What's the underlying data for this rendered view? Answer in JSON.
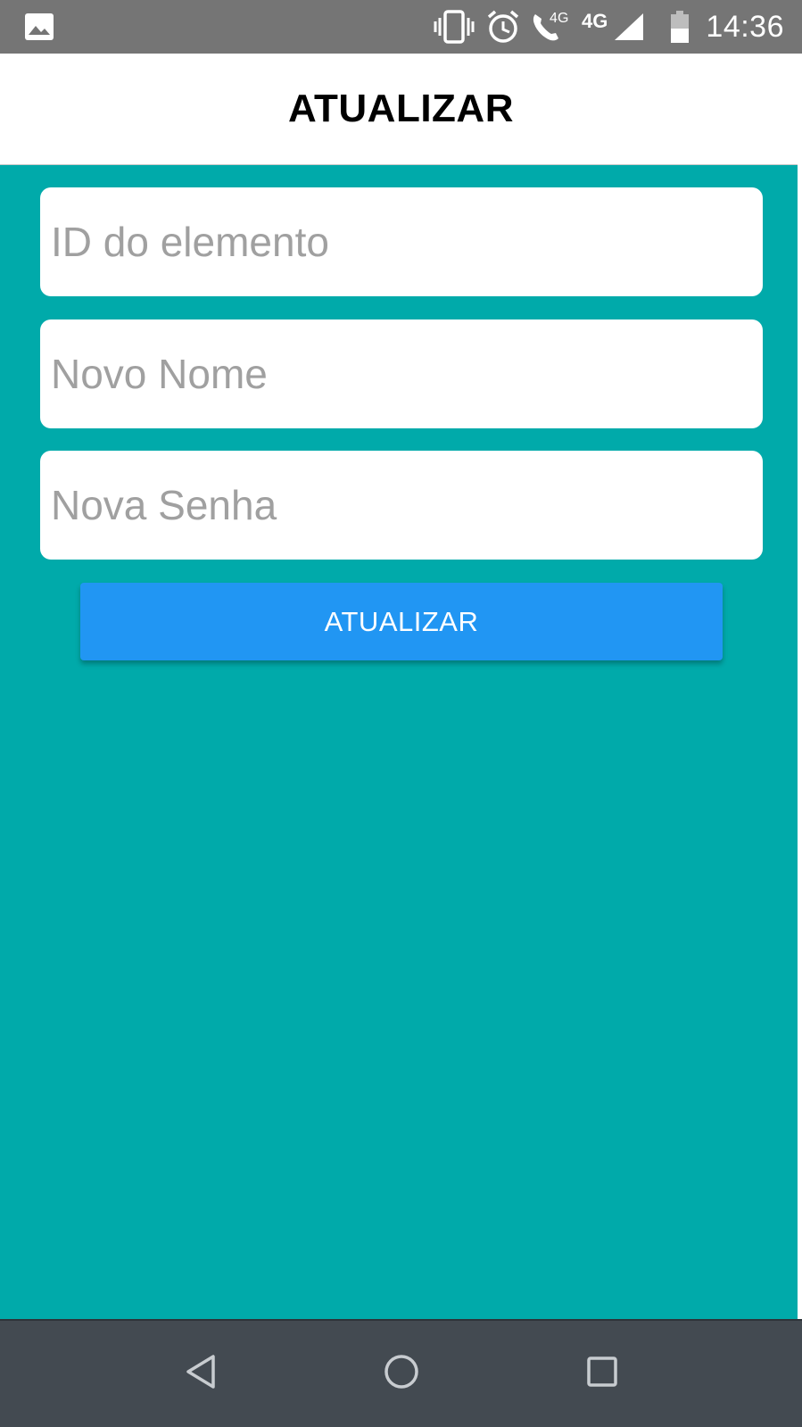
{
  "status_bar": {
    "time": "14:36",
    "network_label": "4G",
    "call_network_label": "4G",
    "icons": [
      "image-icon",
      "vibrate-icon",
      "alarm-icon",
      "volte-call-icon",
      "signal-icon",
      "battery-icon"
    ]
  },
  "app_bar": {
    "title": "ATUALIZAR"
  },
  "form": {
    "id_placeholder": "ID do elemento",
    "id_value": "",
    "name_placeholder": "Novo Nome",
    "name_value": "",
    "password_placeholder": "Nova Senha",
    "password_value": "",
    "submit_label": "ATUALIZAR"
  },
  "nav_bar": {
    "icons": [
      "back-icon",
      "home-icon",
      "recents-icon"
    ]
  },
  "colors": {
    "background": "#00aaaa",
    "status_bar": "#757575",
    "button": "#2196f3",
    "nav_bar": "#434a51"
  }
}
